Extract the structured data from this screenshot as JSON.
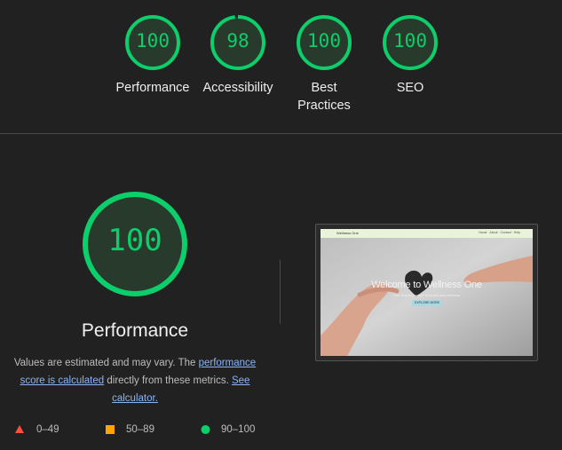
{
  "summary": {
    "categories": [
      {
        "score": "100",
        "label": "Performance",
        "value": 100
      },
      {
        "score": "98",
        "label": "Accessibility",
        "value": 98
      },
      {
        "score": "100",
        "label": "Best Practices",
        "value": 100
      },
      {
        "score": "100",
        "label": "SEO",
        "value": 100
      }
    ]
  },
  "detail": {
    "score": "100",
    "value": 100,
    "title": "Performance",
    "desc_pre": "Values are estimated and may vary. The ",
    "desc_link1": "performance score is calculated",
    "desc_mid": " directly from these metrics. ",
    "desc_link2": "See calculator."
  },
  "legend": {
    "fail": "0–49",
    "average": "50–89",
    "pass": "90–100"
  },
  "screenshot": {
    "brand": "Wellness One",
    "nav_links": "Home · About · Contact · Help",
    "heading": "Welcome to Wellness One",
    "subtext": "Your trusted partner in health and wellness",
    "button": "EXPLORE MORE"
  },
  "colors": {
    "pass": "#0cce6b",
    "average": "#ffa400",
    "fail": "#ff4e42",
    "background": "#212121"
  }
}
